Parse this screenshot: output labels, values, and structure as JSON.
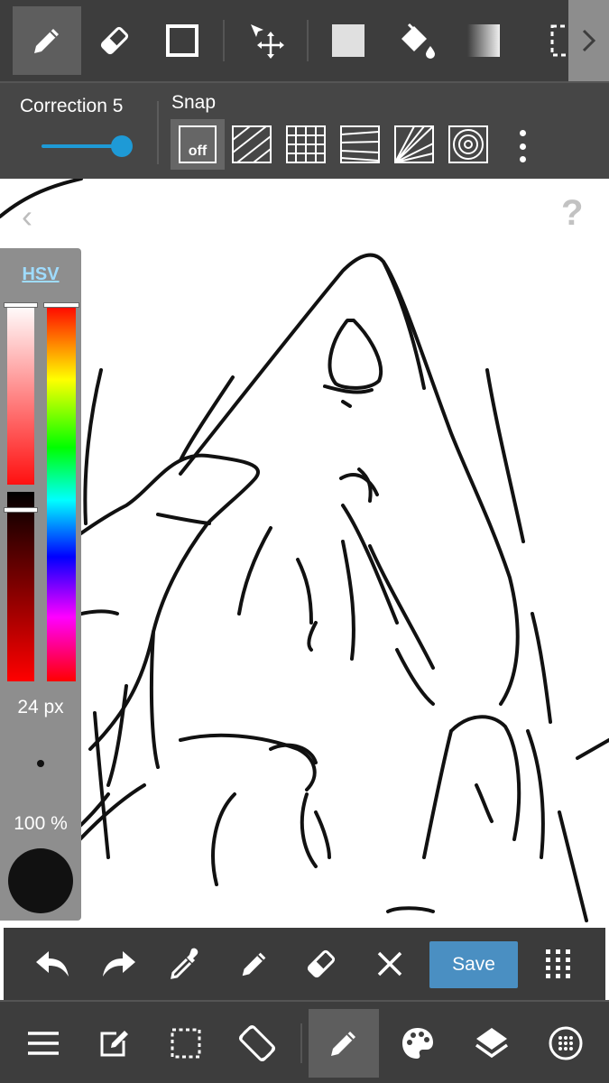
{
  "top_toolbar": {
    "tools": [
      {
        "icon": "pen-icon",
        "active": true
      },
      {
        "icon": "eraser-icon",
        "active": false
      },
      {
        "icon": "shape-rectangle-icon",
        "active": false
      },
      {
        "icon": "move-transform-icon",
        "active": false
      },
      {
        "icon": "fill-rectangle-icon",
        "active": false
      },
      {
        "icon": "paint-bucket-icon",
        "active": false
      },
      {
        "icon": "gradient-icon",
        "active": false
      },
      {
        "icon": "selection-icon",
        "active": false
      }
    ],
    "more_icon": "chevron-right-icon"
  },
  "sub_toolbar": {
    "correction_label": "Correction 5",
    "correction_value": 5,
    "snap_label": "Snap",
    "snap_off_label": "off",
    "snap_modes": [
      "off",
      "parallel",
      "grid",
      "vanishing-lines",
      "radial",
      "concentric"
    ]
  },
  "canvas": {
    "back_glyph": "‹",
    "help_glyph": "?"
  },
  "color_panel": {
    "mode_label": "HSV",
    "brush_size": "24 px",
    "opacity": "100 %",
    "current_color": "#111111"
  },
  "action_bar": {
    "save_label": "Save",
    "actions": [
      "undo-icon",
      "redo-icon",
      "eyedropper-icon",
      "pen-icon",
      "eraser-icon",
      "clear-icon",
      "save",
      "grid-dots-icon"
    ]
  },
  "bottom_nav": {
    "items": [
      "menu-icon",
      "edit-icon",
      "selection-icon",
      "rotate-icon",
      "pen-icon",
      "palette-icon",
      "layers-icon",
      "brush-dot-icon"
    ]
  },
  "colors": {
    "toolbar_bg": "#3d3d3d",
    "accent": "#1e9ad6",
    "save_button": "#4a8fc2",
    "hsv_link": "#9fdcff"
  }
}
